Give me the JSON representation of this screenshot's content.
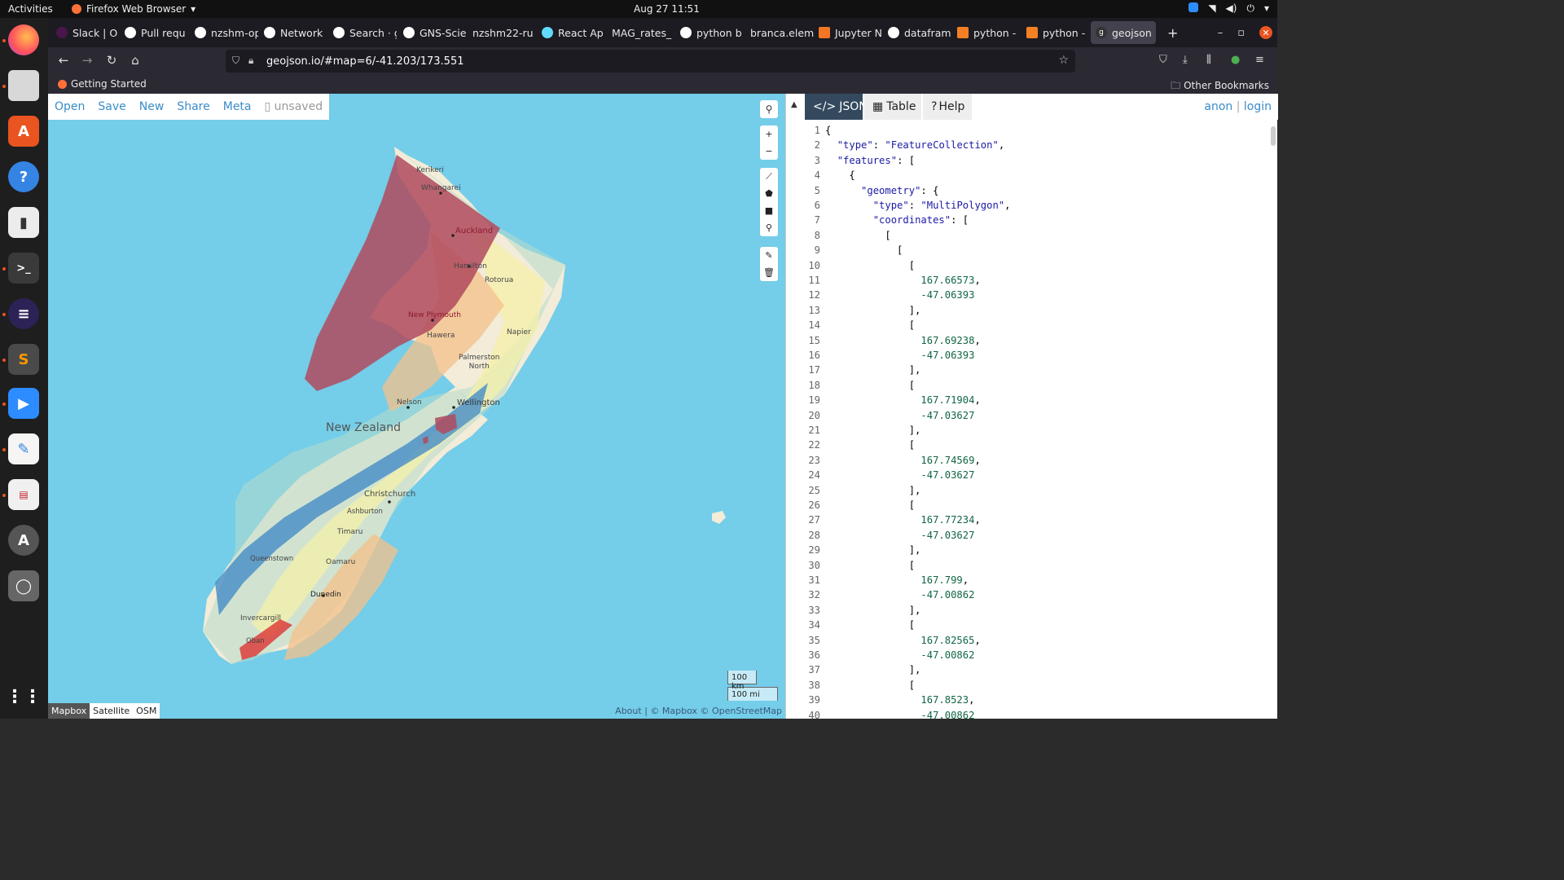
{
  "system": {
    "activities": "Activities",
    "app_name": "Firefox Web Browser",
    "clock": "Aug 27  11:51"
  },
  "browser": {
    "tabs": [
      {
        "label": "Slack | O",
        "color": "#4a154b"
      },
      {
        "label": "Pull requ",
        "color": "#ffffff"
      },
      {
        "label": "nzshm-op",
        "color": "#ffffff"
      },
      {
        "label": "Network",
        "color": "#ffffff"
      },
      {
        "label": "Search · g",
        "color": "#ffffff"
      },
      {
        "label": "GNS-Scie",
        "color": "#ffffff"
      },
      {
        "label": "nzshm22-ru",
        "color": "#ffffff"
      },
      {
        "label": "React Ap",
        "color": "#61dafb"
      },
      {
        "label": "MAG_rates_",
        "color": "#888888"
      },
      {
        "label": "python b",
        "color": "#ffffff"
      },
      {
        "label": "branca.elem",
        "color": "#888888"
      },
      {
        "label": "Jupyter N",
        "color": "#f37626"
      },
      {
        "label": "datafram",
        "color": "#4285f4"
      },
      {
        "label": "python -",
        "color": "#f48024"
      },
      {
        "label": "python -",
        "color": "#f48024"
      },
      {
        "label": "geojson",
        "color": "#333333"
      }
    ],
    "url": "geojson.io/#map=6/-41.203/173.551",
    "bookmark_getting_started": "Getting Started",
    "bookmark_other": "Other Bookmarks"
  },
  "map": {
    "menu": {
      "open": "Open",
      "save": "Save",
      "new": "New",
      "share": "Share",
      "meta": "Meta",
      "status": "unsaved"
    },
    "places": {
      "kerikeri": "Kerikeri",
      "whangarei": "Whangarei",
      "auckland": "Auckland",
      "hamilton": "Hamilton",
      "rotorua": "Rotorua",
      "new_plymouth": "New Plymouth",
      "hawera": "Hawera",
      "napier": "Napier",
      "palmerston_north": "Palmerston",
      "palmerston_north2": "North",
      "wellington": "Wellington",
      "nelson": "Nelson",
      "country": "New Zealand",
      "christchurch": "Christchurch",
      "ashburton": "Ashburton",
      "timaru": "Timaru",
      "queenstown": "Queenstown",
      "oamaru": "Oamaru",
      "dunedin": "Dunedin",
      "invercargill": "Invercargill",
      "oban": "Oban"
    },
    "scale_km": "100 km",
    "scale_mi": "100 mi",
    "layers": [
      "Mapbox",
      "Satellite",
      "OSM"
    ],
    "attribution": "About | © Mapbox © OpenStreetMap"
  },
  "panel": {
    "tabs": {
      "json": "JSON",
      "table": "Table",
      "help": "Help"
    },
    "anon": "anon",
    "login": "login",
    "lines": [
      "{",
      "  \"type\": \"FeatureCollection\",",
      "  \"features\": [",
      "    {",
      "      \"geometry\": {",
      "        \"type\": \"MultiPolygon\",",
      "        \"coordinates\": [",
      "          [",
      "            [",
      "              [",
      "                167.66573,",
      "                -47.06393",
      "              ],",
      "              [",
      "                167.69238,",
      "                -47.06393",
      "              ],",
      "              [",
      "                167.71904,",
      "                -47.03627",
      "              ],",
      "              [",
      "                167.74569,",
      "                -47.03627",
      "              ],",
      "              [",
      "                167.77234,",
      "                -47.03627",
      "              ],",
      "              [",
      "                167.799,",
      "                -47.00862",
      "              ],",
      "              [",
      "                167.82565,",
      "                -47.00862",
      "              ],",
      "              [",
      "                167.8523,",
      "                -47.00862"
    ]
  }
}
